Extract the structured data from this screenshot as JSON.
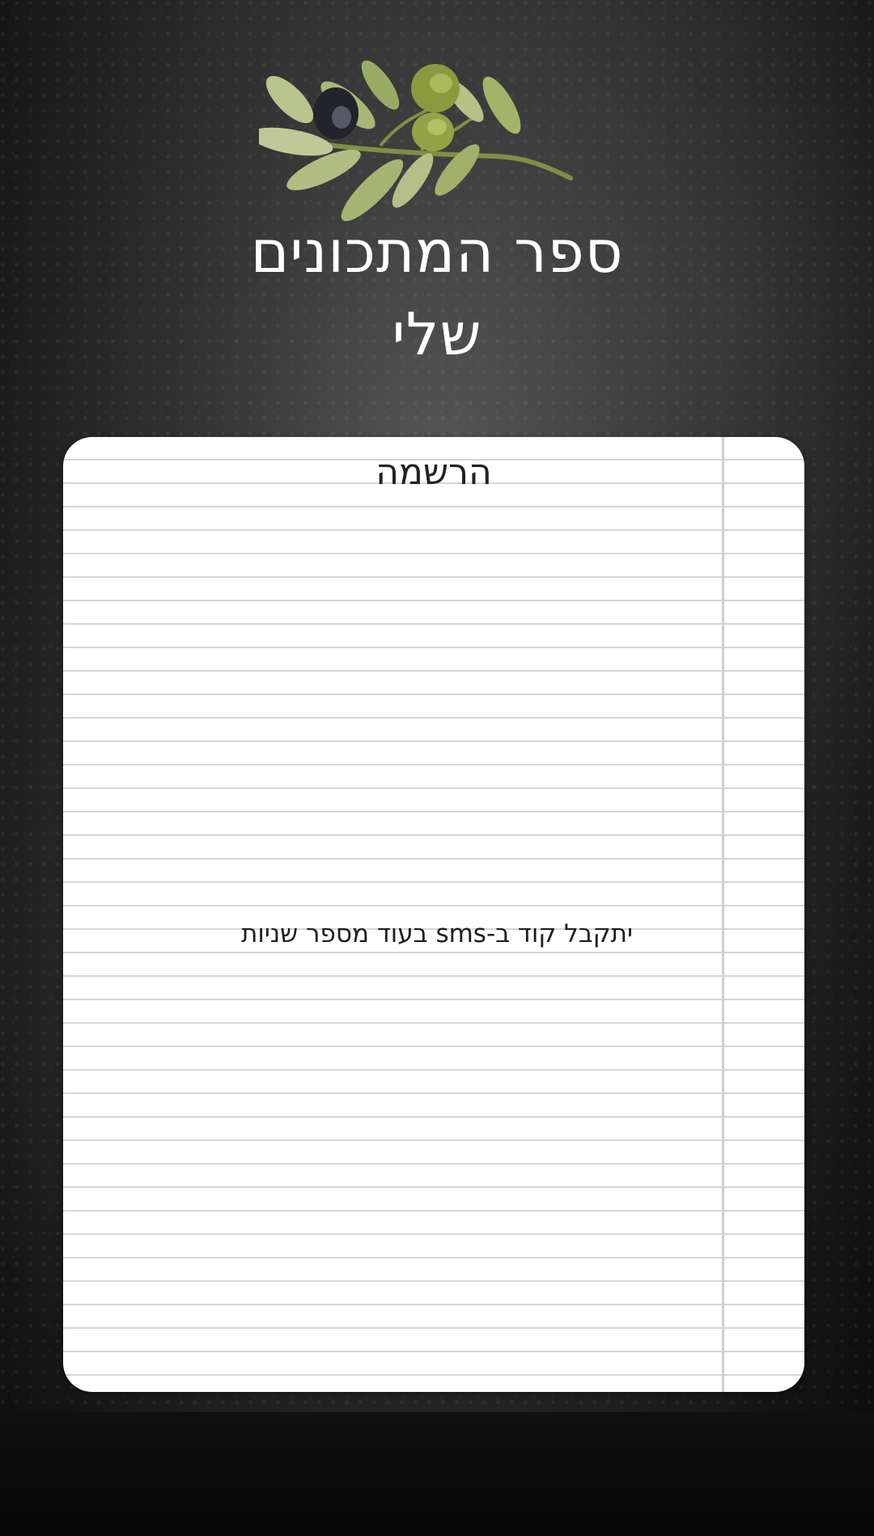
{
  "header": {
    "title_line1": "ספר המתכונים",
    "title_line2": "שלי",
    "decoration_icon": "olive-branch-icon"
  },
  "card": {
    "heading": "הרשמה",
    "message": "יתקבל קוד ב-sms בעוד מספר שניות"
  },
  "colors": {
    "background": "#2e2e2e",
    "card": "#ffffff",
    "ruled_line": "#d6d6d6",
    "title_text": "#ffffff"
  }
}
